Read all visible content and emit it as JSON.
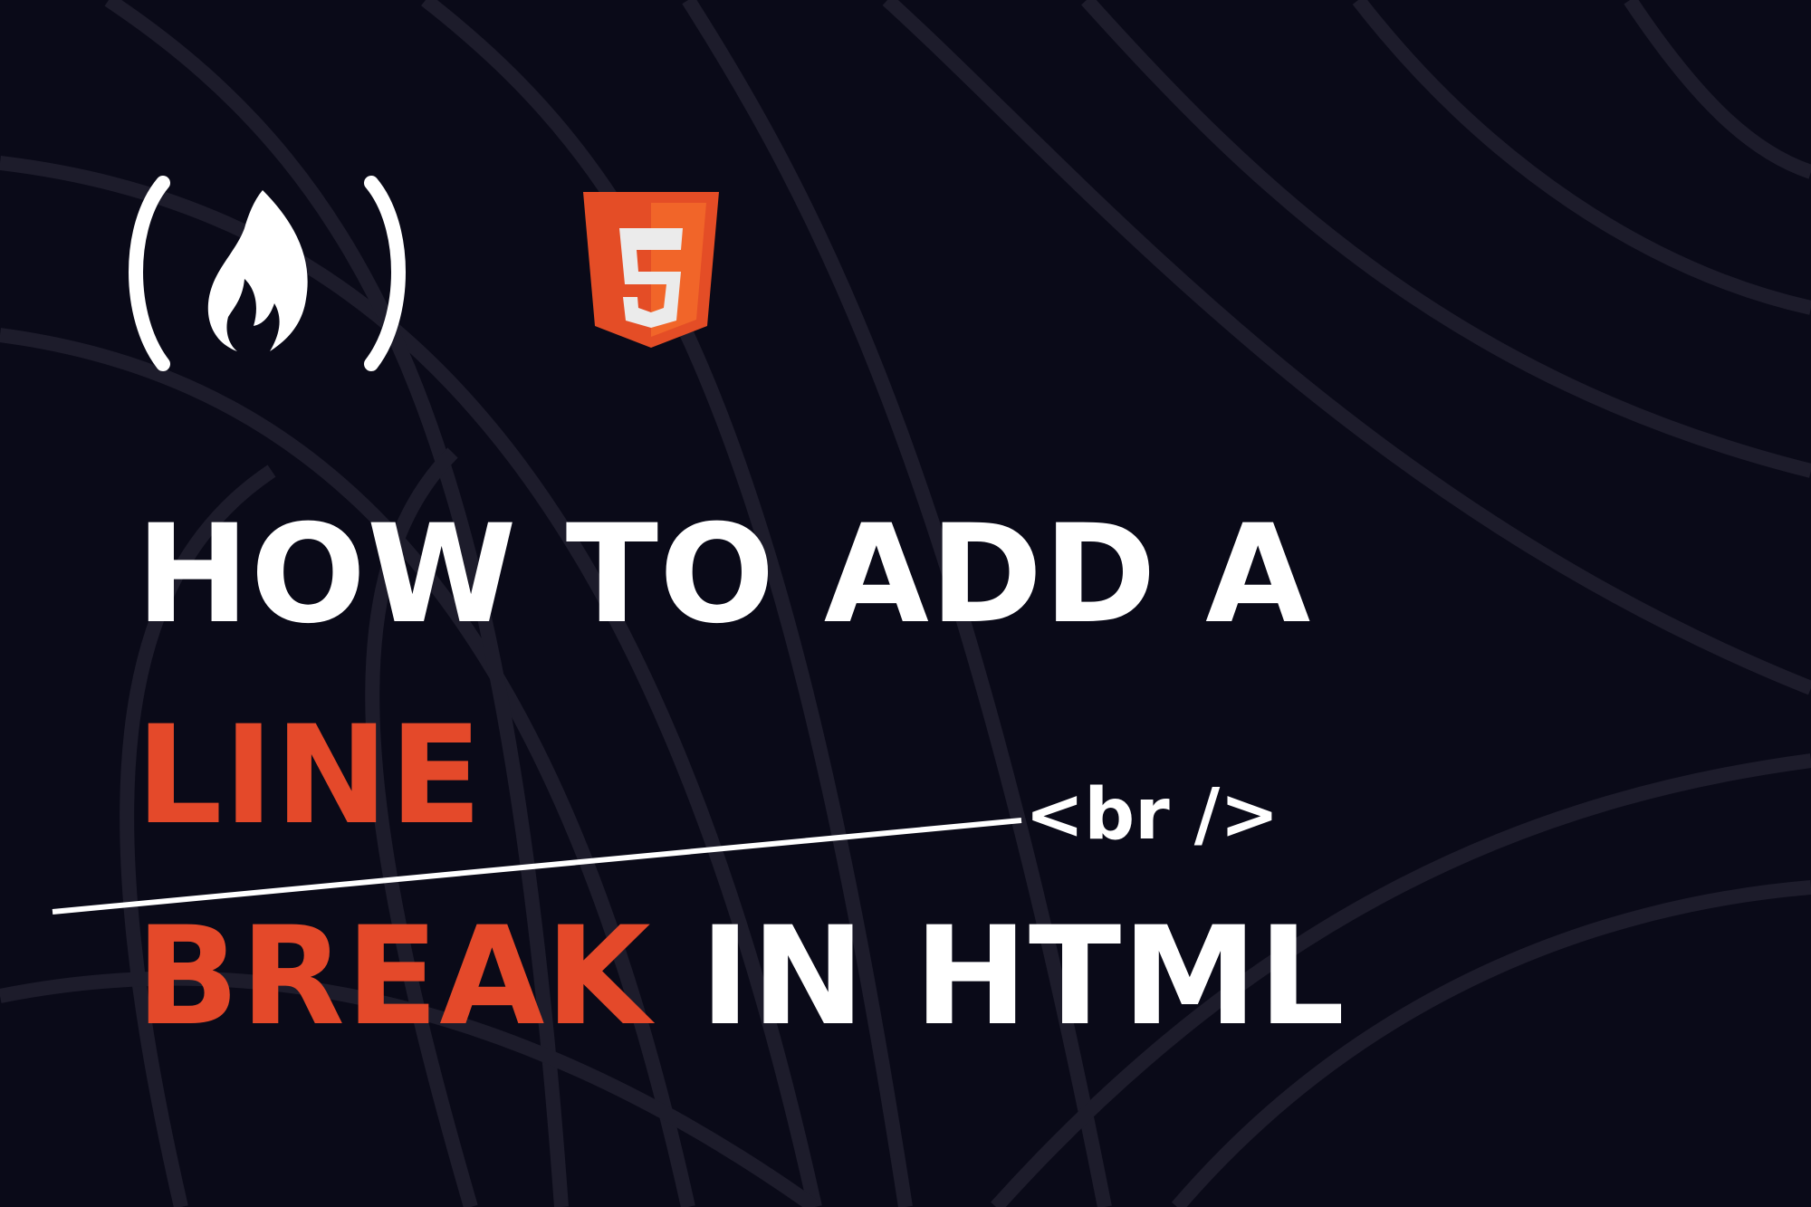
{
  "headline": {
    "line1": "HOW TO ADD A",
    "line2": "LINE",
    "line3_highlight": "BREAK",
    "line3_rest": " IN HTML"
  },
  "tag": "<br />",
  "icons": {
    "brand": "freecodecamp-logo-icon",
    "tech": "html5-logo-icon"
  },
  "colors": {
    "background": "#0a0a18",
    "accent": "#e4492a",
    "text": "#ffffff",
    "html5_orange": "#e44d26",
    "html5_light": "#f16529"
  }
}
